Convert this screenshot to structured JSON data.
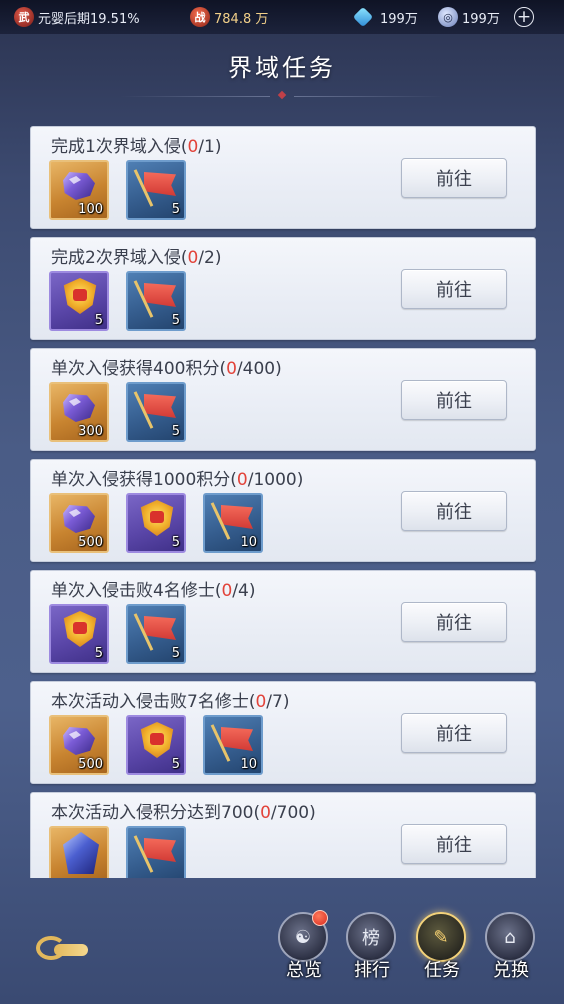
{
  "topbar": {
    "realm_icon": "wu-glyph-icon",
    "realm_icon_glyph": "武",
    "realm_text": "元婴后期19.51%",
    "power_icon": "zhan-glyph-icon",
    "power_icon_glyph": "战",
    "power_value": "784.8 万",
    "gem_icon": "blue-gem-icon",
    "gem_value": "199万",
    "coin_icon": "spirit-coin-icon",
    "coin_value": "199万",
    "add_icon": "plus-icon"
  },
  "title": "界域任务",
  "tasks": [
    {
      "title_prefix": "完成1次界域入侵(",
      "progress_current": "0",
      "title_suffix": "/1)",
      "rewards": [
        {
          "icon": "purple-ore-icon",
          "quality": "orange",
          "count": "100"
        },
        {
          "icon": "red-banner-icon",
          "quality": "blue",
          "count": "5"
        }
      ],
      "button": "前往"
    },
    {
      "title_prefix": "完成2次界域入侵(",
      "progress_current": "0",
      "title_suffix": "/2)",
      "rewards": [
        {
          "icon": "golden-shield-icon",
          "quality": "purple",
          "count": "5"
        },
        {
          "icon": "red-banner-icon",
          "quality": "blue",
          "count": "5"
        }
      ],
      "button": "前往"
    },
    {
      "title_prefix": "单次入侵获得400积分(",
      "progress_current": "0",
      "title_suffix": "/400)",
      "rewards": [
        {
          "icon": "purple-ore-icon",
          "quality": "orange",
          "count": "300"
        },
        {
          "icon": "red-banner-icon",
          "quality": "blue",
          "count": "5"
        }
      ],
      "button": "前往"
    },
    {
      "title_prefix": "单次入侵获得1000积分(",
      "progress_current": "0",
      "title_suffix": "/1000)",
      "rewards": [
        {
          "icon": "purple-ore-icon",
          "quality": "orange",
          "count": "500"
        },
        {
          "icon": "golden-shield-icon",
          "quality": "purple",
          "count": "5"
        },
        {
          "icon": "red-banner-icon",
          "quality": "blue",
          "count": "10"
        }
      ],
      "button": "前往"
    },
    {
      "title_prefix": "单次入侵击败4名修士(",
      "progress_current": "0",
      "title_suffix": "/4)",
      "rewards": [
        {
          "icon": "golden-shield-icon",
          "quality": "purple",
          "count": "5"
        },
        {
          "icon": "red-banner-icon",
          "quality": "blue",
          "count": "5"
        }
      ],
      "button": "前往"
    },
    {
      "title_prefix": "本次活动入侵击败7名修士(",
      "progress_current": "0",
      "title_suffix": "/7)",
      "rewards": [
        {
          "icon": "purple-ore-icon",
          "quality": "orange",
          "count": "500"
        },
        {
          "icon": "golden-shield-icon",
          "quality": "purple",
          "count": "5"
        },
        {
          "icon": "red-banner-icon",
          "quality": "blue",
          "count": "10"
        }
      ],
      "button": "前往"
    },
    {
      "title_prefix": "本次活动入侵积分达到700(",
      "progress_current": "0",
      "title_suffix": "/700)",
      "rewards": [
        {
          "icon": "blue-crystal-icon",
          "quality": "orange",
          "count": ""
        },
        {
          "icon": "red-banner-icon",
          "quality": "blue",
          "count": ""
        }
      ],
      "button": "前往"
    }
  ],
  "bottom_nav": {
    "menu_icon": "cloud-swirl-icon",
    "items": [
      {
        "icon": "overview-swirl-icon",
        "glyph": "☯",
        "label": "总览",
        "badge": true,
        "active": false
      },
      {
        "icon": "ranking-book-icon",
        "glyph": "榜",
        "label": "排行",
        "badge": false,
        "active": false
      },
      {
        "icon": "task-scroll-icon",
        "glyph": "✎",
        "label": "任务",
        "badge": false,
        "active": true
      },
      {
        "icon": "exchange-pavilion-icon",
        "glyph": "⌂",
        "label": "兑换",
        "badge": false,
        "active": false
      }
    ]
  },
  "colors": {
    "progress_red": "#e2433a",
    "panel_bg": "#eef1f7",
    "active_gold": "#f3d27a"
  }
}
